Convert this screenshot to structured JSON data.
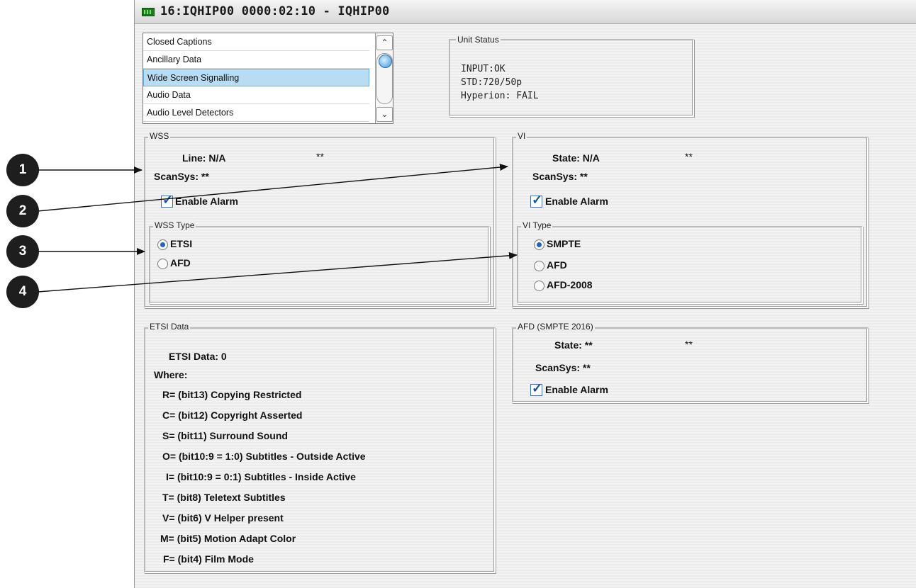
{
  "window": {
    "title": "16:IQHIP00  0000:02:10  - IQHIP00"
  },
  "listbox": {
    "items": [
      "Closed Captions",
      "Ancillary Data",
      "Wide Screen Signalling",
      "Audio Data",
      "Audio Level Detectors"
    ],
    "selected_index": 2
  },
  "unit_status": {
    "title": "Unit Status",
    "lines": [
      "INPUT:OK",
      "STD:720/50p",
      "Hyperion: FAIL"
    ]
  },
  "wss": {
    "title": "WSS",
    "line_label": "Line: N/A",
    "line_value": "**",
    "scansys_label": "ScanSys: **",
    "enable_alarm_label": "Enable Alarm",
    "enable_alarm_checked": true,
    "type_group": {
      "title": "WSS Type",
      "options": [
        "ETSI",
        "AFD"
      ],
      "selected": "ETSI"
    }
  },
  "vi": {
    "title": "VI",
    "state_label": "State: N/A",
    "state_value": "**",
    "scansys_label": "ScanSys: **",
    "enable_alarm_label": "Enable Alarm",
    "enable_alarm_checked": true,
    "type_group": {
      "title": "VI Type",
      "options": [
        "SMPTE",
        "AFD",
        "AFD-2008"
      ],
      "selected": "SMPTE"
    }
  },
  "etsi_data": {
    "title": "ETSI Data",
    "value_label": "ETSI Data: 0",
    "where_label": "Where:",
    "bits": [
      "R= (bit13)  Copying Restricted",
      "C= (bit12)  Copyright Asserted",
      "S= (bit11)  Surround Sound",
      "O= (bit10:9 = 1:0) Subtitles - Outside Active",
      "I= (bit10:9 = 0:1) Subtitles - Inside Active",
      "T= (bit8)   Teletext Subtitles",
      "V= (bit6)   V Helper present",
      "M= (bit5)   Motion Adapt Color",
      "F= (bit4)   Film Mode"
    ]
  },
  "afd_smpte": {
    "title": "AFD (SMPTE 2016)",
    "state_label": "State: **",
    "state_value": "**",
    "scansys_label": "ScanSys: **",
    "enable_alarm_label": "Enable Alarm",
    "enable_alarm_checked": true
  },
  "callouts": [
    "1",
    "2",
    "3",
    "4"
  ],
  "icons": {
    "title_icon": "monitor-icon",
    "scroll_up": "arrow-up-icon",
    "scroll_down": "arrow-down-icon",
    "check": "checkmark-icon"
  },
  "colors": {
    "selection": "#b9dcf2",
    "check": "#1b4f9c",
    "radio": "#2366b8",
    "callout": "#1e1e1e"
  }
}
